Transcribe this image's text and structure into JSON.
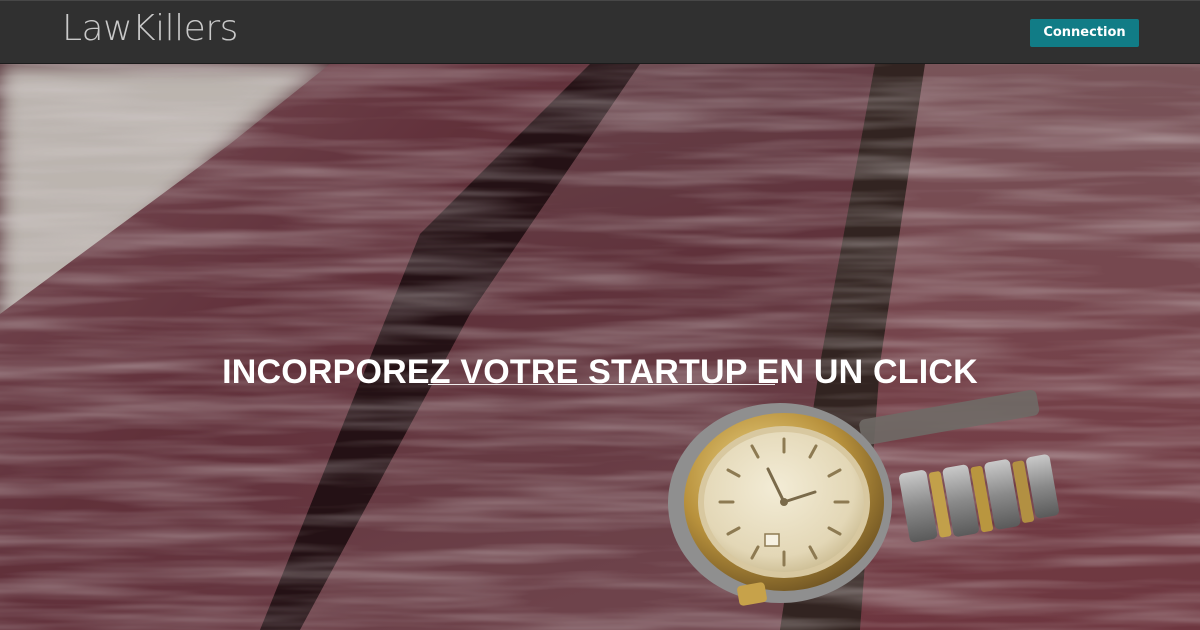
{
  "header": {
    "brand": "LawKillers",
    "connection_label": "Connection",
    "accent_color": "#117c86"
  },
  "hero": {
    "title": "INCORPOREZ VOTRE STARTUP EN UN CLICK",
    "background": "weathered-red-wooden-bench-with-wristwatch"
  }
}
